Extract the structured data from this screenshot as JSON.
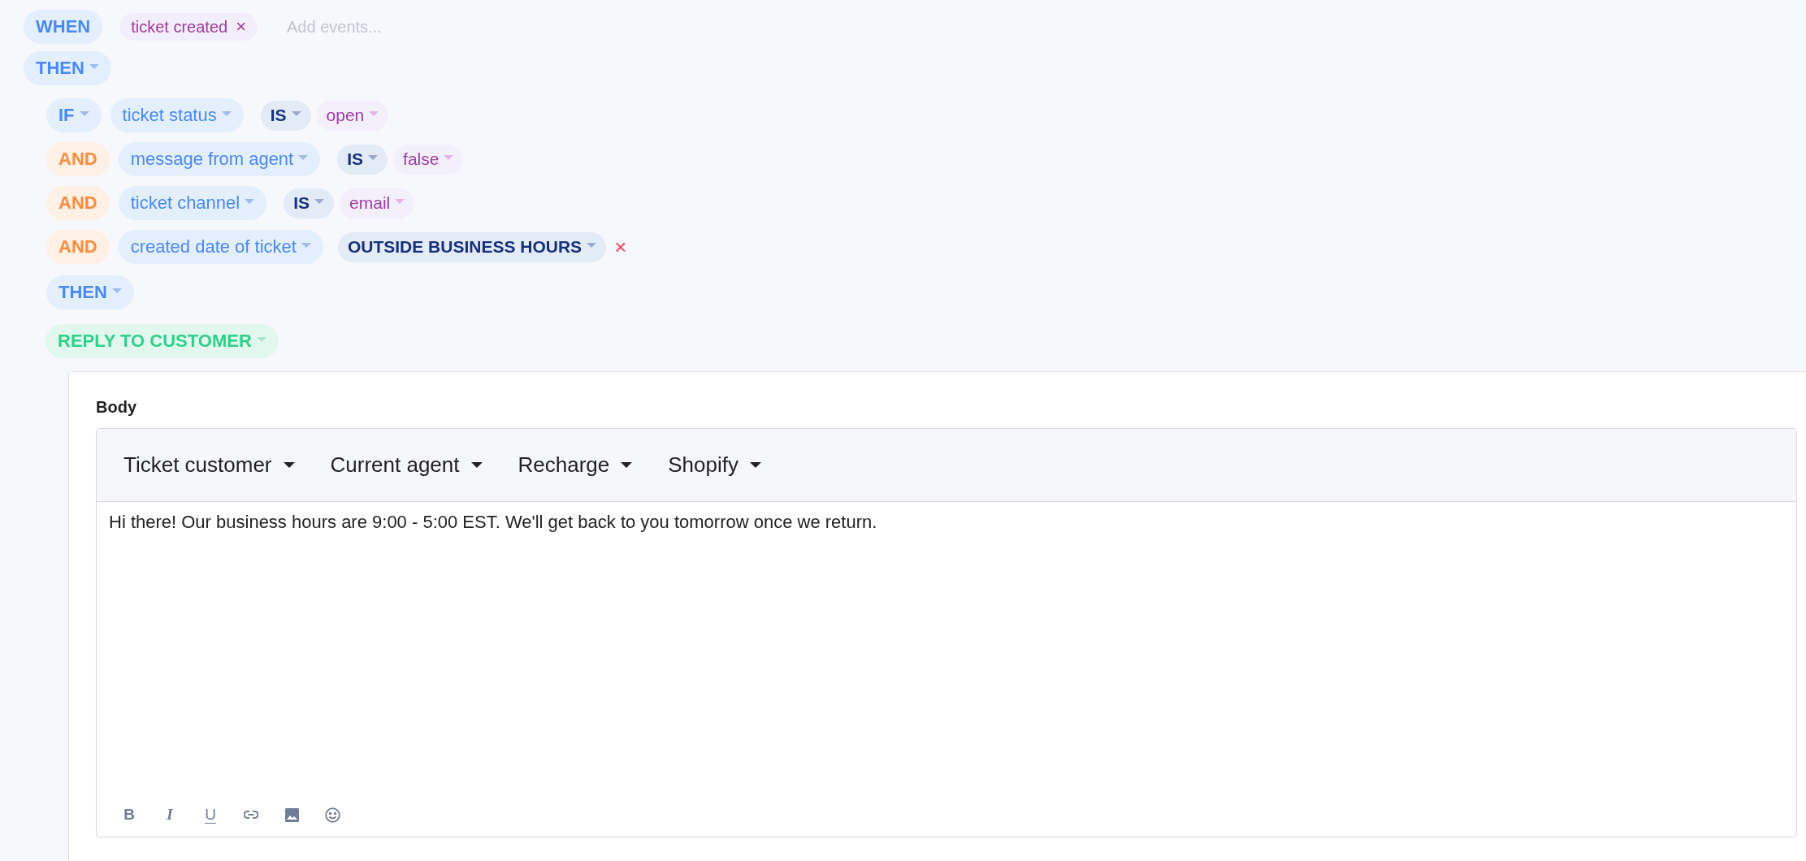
{
  "trigger": {
    "keyword": "WHEN",
    "events": [
      {
        "label": "ticket created",
        "remove": "×"
      }
    ],
    "placeholder": "Add events..."
  },
  "then": {
    "label": "THEN",
    "children": [
      {
        "kind": "condition_block",
        "conditions": [
          {
            "tokens": [
              {
                "kind": "connector",
                "text": "IF"
              },
              {
                "kind": "field",
                "text": "ticket status"
              },
              {
                "kind": "operator",
                "text": "IS"
              },
              {
                "kind": "value",
                "text": "open"
              }
            ]
          },
          {
            "tokens": [
              {
                "kind": "joiner",
                "text": "AND"
              },
              {
                "kind": "field",
                "text": "message from agent"
              },
              {
                "kind": "operator",
                "text": "IS"
              },
              {
                "kind": "value",
                "text": "false"
              }
            ]
          },
          {
            "tokens": [
              {
                "kind": "joiner",
                "text": "AND"
              },
              {
                "kind": "field",
                "text": "ticket channel"
              },
              {
                "kind": "operator",
                "text": "IS"
              },
              {
                "kind": "value",
                "text": "email"
              }
            ]
          },
          {
            "tokens": [
              {
                "kind": "joiner",
                "text": "AND"
              },
              {
                "kind": "field",
                "text": "created date of ticket"
              },
              {
                "kind": "constant",
                "text": "OUTSIDE BUSINESS HOURS"
              },
              {
                "kind": "remove",
                "text": "×"
              }
            ]
          }
        ],
        "then": {
          "label": "THEN",
          "children": [
            {
              "kind": "action",
              "label": "REPLY TO CUSTOMER",
              "body": {
                "label": "Body",
                "menus": [
                  "Ticket customer",
                  "Current agent",
                  "Recharge",
                  "Shopify"
                ],
                "text": "Hi there! Our business hours are 9:00 - 5:00 EST. We'll get back to you tomorrow once we return.",
                "format_buttons": [
                  {
                    "kind": "bold",
                    "label": "B"
                  },
                  {
                    "kind": "italic",
                    "label": "I"
                  },
                  {
                    "kind": "underline",
                    "label": "U"
                  },
                  {
                    "kind": "link"
                  },
                  {
                    "kind": "image"
                  },
                  {
                    "kind": "emoji"
                  }
                ]
              }
            }
          ]
        }
      }
    ]
  }
}
